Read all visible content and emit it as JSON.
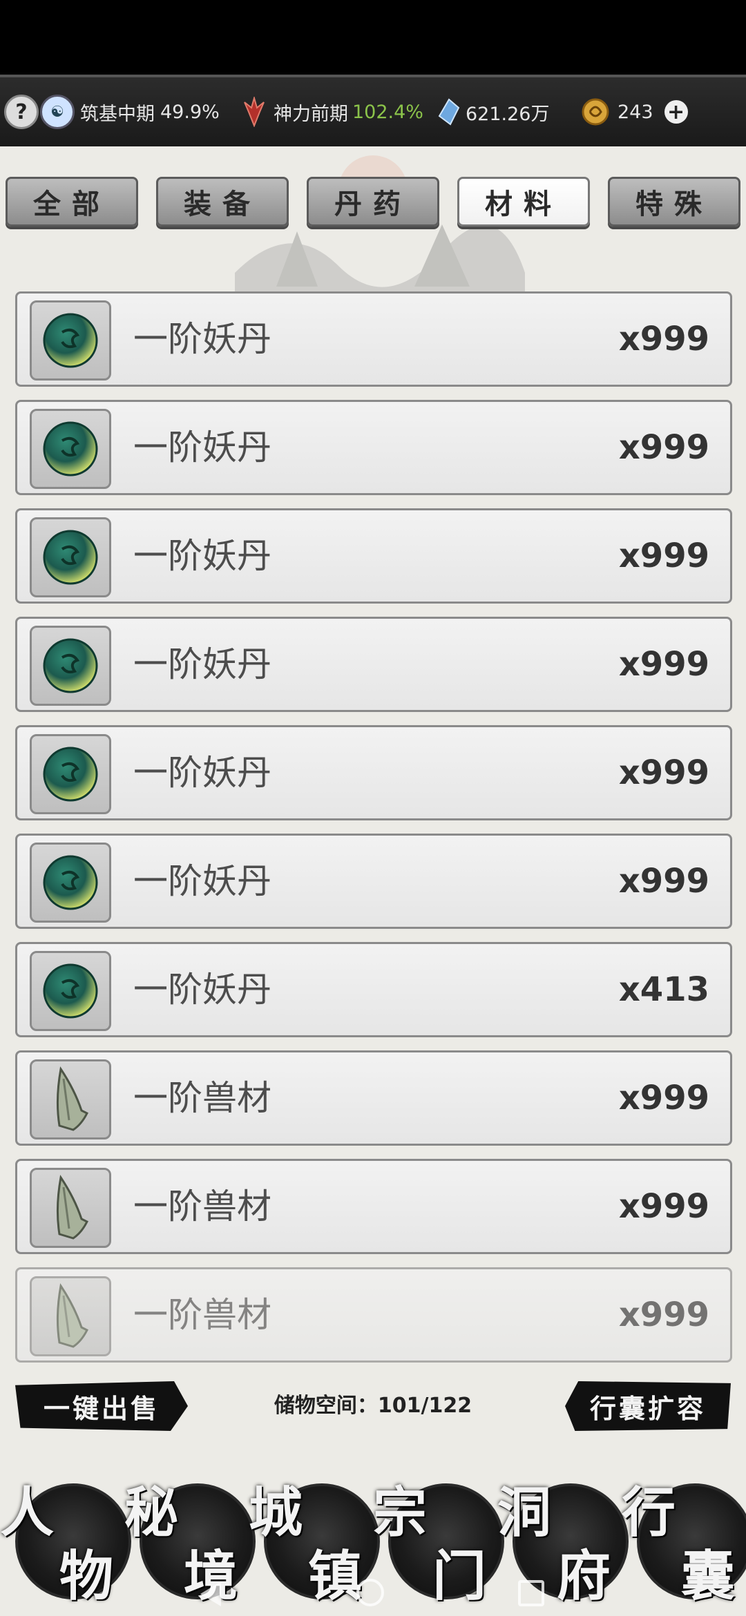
{
  "status": {
    "help_icon": "?",
    "cultivation_label": "筑基中期",
    "cultivation_value": "49.9%",
    "power_label": "神力前期",
    "power_value": "102.4%",
    "crystals": "621.26万",
    "coins": "243",
    "plus_icon": "+"
  },
  "tabs": [
    "全部",
    "装备",
    "丹药",
    "材料",
    "特殊"
  ],
  "active_tab": "材料",
  "items": [
    {
      "name": "一阶妖丹",
      "count": "x999",
      "icon": "demon-core-icon"
    },
    {
      "name": "一阶妖丹",
      "count": "x999",
      "icon": "demon-core-icon"
    },
    {
      "name": "一阶妖丹",
      "count": "x999",
      "icon": "demon-core-icon"
    },
    {
      "name": "一阶妖丹",
      "count": "x999",
      "icon": "demon-core-icon"
    },
    {
      "name": "一阶妖丹",
      "count": "x999",
      "icon": "demon-core-icon"
    },
    {
      "name": "一阶妖丹",
      "count": "x999",
      "icon": "demon-core-icon"
    },
    {
      "name": "一阶妖丹",
      "count": "x413",
      "icon": "demon-core-icon"
    },
    {
      "name": "一阶兽材",
      "count": "x999",
      "icon": "beast-horn-icon"
    },
    {
      "name": "一阶兽材",
      "count": "x999",
      "icon": "beast-horn-icon"
    },
    {
      "name": "一阶兽材",
      "count": "x999",
      "icon": "beast-horn-icon"
    }
  ],
  "bottom": {
    "sell_all": "一键出售",
    "storage_label": "储物空间：",
    "storage_value": "101/122",
    "expand": "行囊扩容"
  },
  "nav": [
    {
      "c1": "人",
      "c2": "物"
    },
    {
      "c1": "秘",
      "c2": "境"
    },
    {
      "c1": "城",
      "c2": "镇"
    },
    {
      "c1": "宗",
      "c2": "门"
    },
    {
      "c1": "洞",
      "c2": "府"
    },
    {
      "c1": "行",
      "c2": "囊"
    }
  ]
}
